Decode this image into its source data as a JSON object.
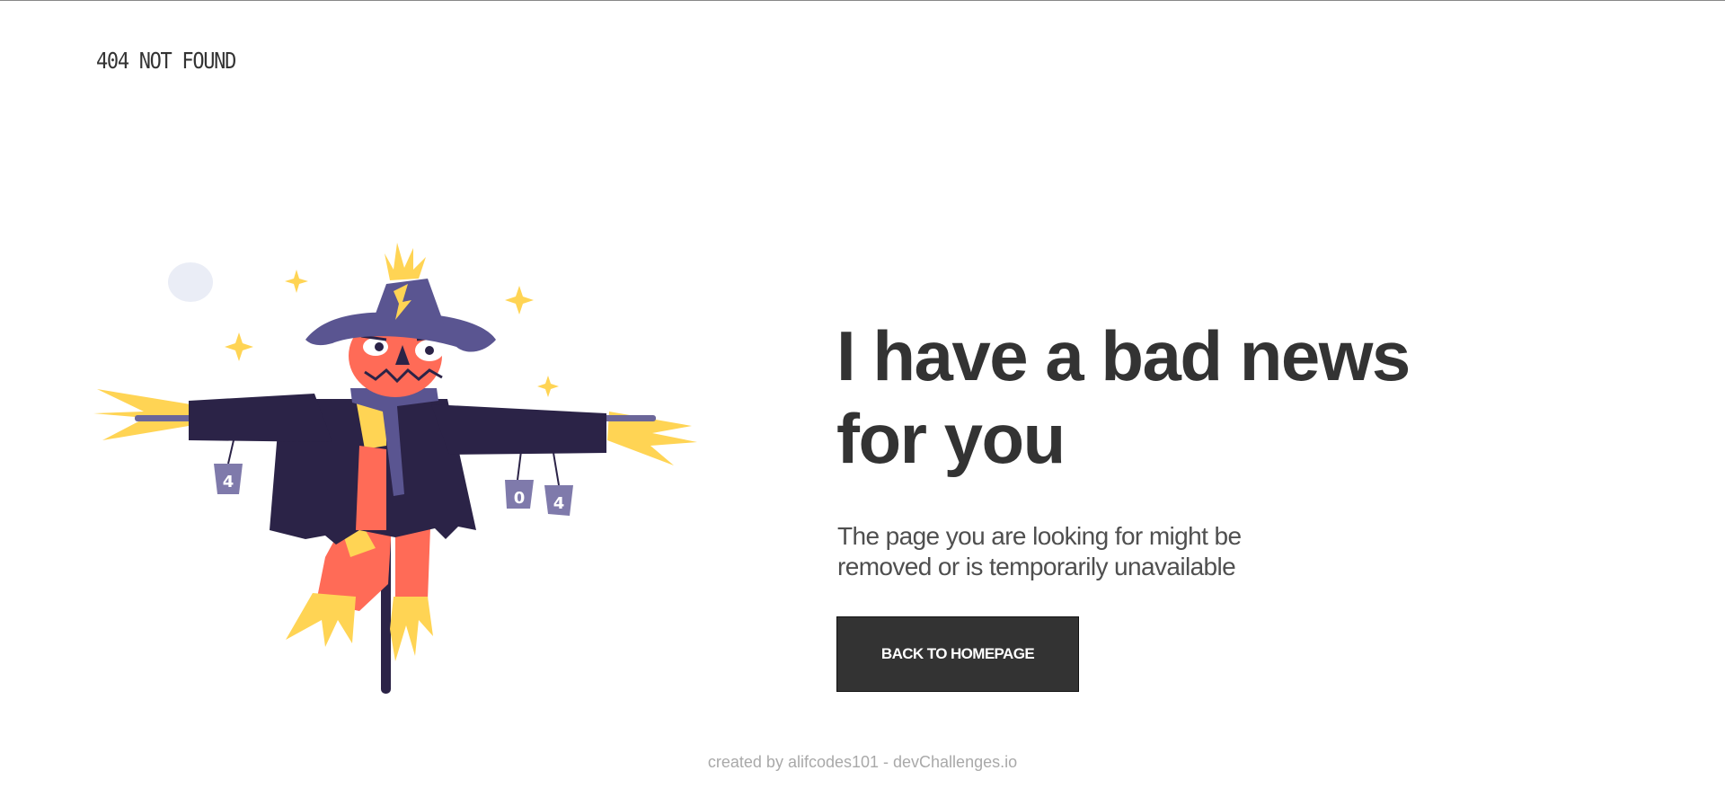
{
  "header": {
    "brand": "404 NOT FOUND"
  },
  "main": {
    "headline_line1": "I have a bad news",
    "headline_line2": "for you",
    "subtext_line1": "The page you are looking for might be",
    "subtext_line2": "removed or is temporarily unavailable",
    "cta_label": "BACK TO HOMEPAGE"
  },
  "illustration": {
    "can_labels": [
      "4",
      "0",
      "4"
    ]
  },
  "footer": {
    "credit": "created by alifcodes101 - devChallenges.io"
  },
  "colors": {
    "text_dark": "#333333",
    "text_body": "#4f4f4f",
    "footer_text": "#a9a9a9",
    "button_bg": "#333333",
    "scarecrow_coat": "#2b2347",
    "scarecrow_hat": "#5a5591",
    "scarecrow_skin": "#ff6b57",
    "straw": "#ffd454",
    "can": "#7f7aab",
    "moon": "#eaedf6"
  }
}
